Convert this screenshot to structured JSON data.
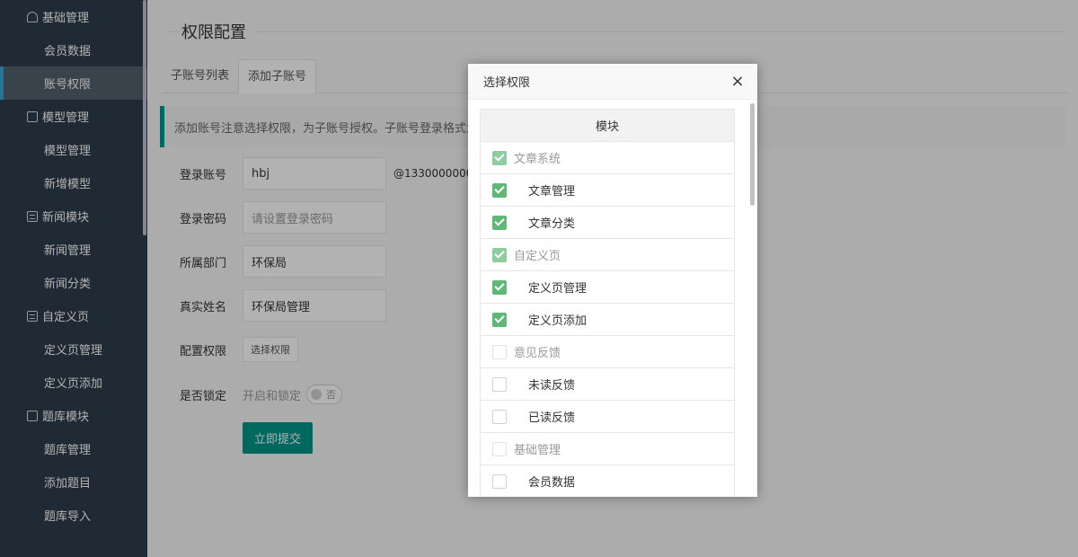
{
  "sidebar": {
    "groups": [
      {
        "title": "基础管理",
        "icon": "user-icon",
        "items": [
          "会员数据",
          "账号权限"
        ]
      },
      {
        "title": "模型管理",
        "icon": "model-icon",
        "items": [
          "模型管理",
          "新增模型"
        ]
      },
      {
        "title": "新闻模块",
        "icon": "list-icon",
        "items": [
          "新闻管理",
          "新闻分类"
        ]
      },
      {
        "title": "自定义页",
        "icon": "page-icon",
        "items": [
          "定义页管理",
          "定义页添加"
        ]
      },
      {
        "title": "题库模块",
        "icon": "book-icon",
        "items": [
          "题库管理",
          "添加题目",
          "题库导入"
        ]
      }
    ],
    "active_item": "账号权限"
  },
  "main": {
    "title": "权限配置",
    "tabs": [
      "子账号列表",
      "添加子账号"
    ],
    "active_tab": "添加子账号",
    "notice": "添加账号注意选择权限，为子账号授权。子账号登录格式为：",
    "form": {
      "account_label": "登录账号",
      "account_value": "hbj",
      "account_suffix": "@13300000001",
      "password_label": "登录密码",
      "password_placeholder": "请设置登录密码",
      "department_label": "所属部门",
      "department_value": "环保局",
      "realname_label": "真实姓名",
      "realname_value": "环保局管理",
      "permission_label": "配置权限",
      "permission_button": "选择权限",
      "lock_label": "是否锁定",
      "lock_text": "开启和锁定",
      "lock_switch": "否",
      "submit": "立即提交"
    }
  },
  "modal": {
    "title": "选择权限",
    "close": "×",
    "header": "模块",
    "rows": [
      {
        "label": "文章系统",
        "level": "parent",
        "checked": true
      },
      {
        "label": "文章管理",
        "level": "child",
        "checked": true
      },
      {
        "label": "文章分类",
        "level": "child",
        "checked": true
      },
      {
        "label": "自定义页",
        "level": "parent",
        "checked": true
      },
      {
        "label": "定义页管理",
        "level": "child",
        "checked": true
      },
      {
        "label": "定义页添加",
        "level": "child",
        "checked": true
      },
      {
        "label": "意见反馈",
        "level": "parent",
        "checked": false
      },
      {
        "label": "未读反馈",
        "level": "child",
        "checked": false
      },
      {
        "label": "已读反馈",
        "level": "child",
        "checked": false
      },
      {
        "label": "基础管理",
        "level": "parent",
        "checked": false
      },
      {
        "label": "会员数据",
        "level": "child",
        "checked": false
      }
    ]
  },
  "colors": {
    "sidebar_bg": "#2f3d4c",
    "sidebar_active": "#52606e",
    "accent": "#009688",
    "checkbox_checked": "#5fb878"
  }
}
